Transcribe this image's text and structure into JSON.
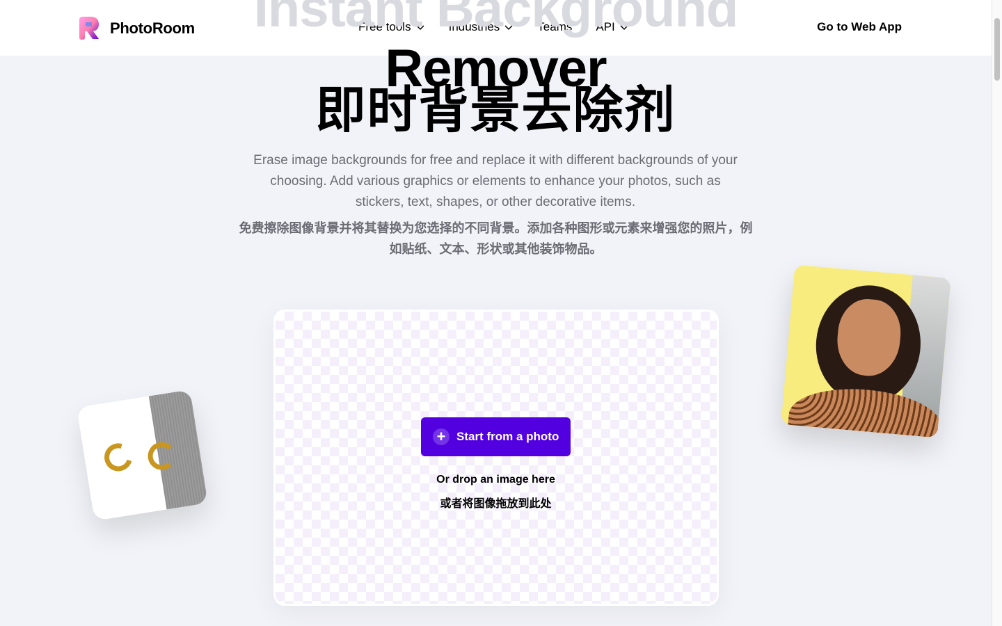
{
  "header": {
    "logo_text": "PhotoRoom",
    "nav": [
      {
        "label": "Free tools",
        "dropdown": true
      },
      {
        "label": "Industries",
        "dropdown": true
      },
      {
        "label": "Teams",
        "dropdown": false
      },
      {
        "label": "API",
        "dropdown": true
      }
    ],
    "cta": "Go to Web App"
  },
  "hero": {
    "title_line1": "Instant Background",
    "title_line2": "Remover",
    "title_cn": "即时背景去除剂",
    "description": "Erase image backgrounds for free and replace it with different backgrounds of your choosing. Add various graphics or elements to enhance your photos, such as stickers, text, shapes, or other decorative items.",
    "description_cn": "免费擦除图像背景并将其替换为您选择的不同背景。添加各种图形或元素来增强您的照片，例如贴纸、文本、形状或其他装饰物品。"
  },
  "upload": {
    "button_label": "Start from a photo",
    "drop_text": "Or drop an image here",
    "drop_text_cn": "或者将图像拖放到此处"
  },
  "colors": {
    "accent": "#5200e0",
    "background": "#f2f3f8"
  }
}
